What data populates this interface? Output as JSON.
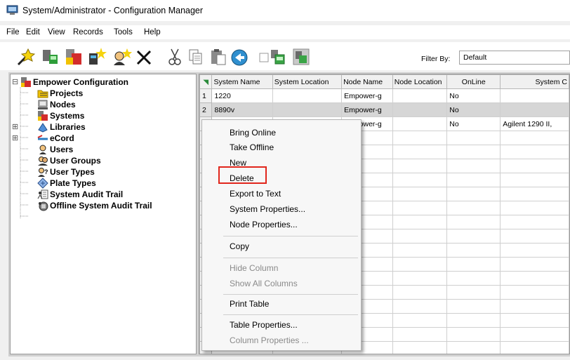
{
  "window": {
    "title": "System/Administrator - Configuration Manager"
  },
  "menu": [
    "File",
    "Edit",
    "View",
    "Records",
    "Tools",
    "Help"
  ],
  "toolbar": {
    "filter_label": "Filter By:",
    "filter_value": "Default",
    "icons": [
      "new-wand-icon",
      "node-icon",
      "system-icon",
      "new-sparkle-icon",
      "user-sparkle-icon",
      "delete-x-icon",
      "cut-icon",
      "copy-icon",
      "paste-icon",
      "go-online-icon",
      "checkbox-icon",
      "system-config-icon",
      "system-config-alt-icon"
    ]
  },
  "tree": {
    "items": [
      {
        "label": "Empower Configuration",
        "icon": "empower-config-icon",
        "expander": "⊟"
      },
      {
        "label": "Projects",
        "icon": "projects-folder-icon"
      },
      {
        "label": "Nodes",
        "icon": "nodes-icon"
      },
      {
        "label": "Systems",
        "icon": "systems-icon"
      },
      {
        "label": "Libraries",
        "icon": "libraries-icon",
        "expander": "⊞"
      },
      {
        "label": "eCord",
        "icon": "ecord-icon",
        "expander": "⊞"
      },
      {
        "label": "Users",
        "icon": "users-icon"
      },
      {
        "label": "User Groups",
        "icon": "user-groups-icon"
      },
      {
        "label": "User Types",
        "icon": "user-types-icon"
      },
      {
        "label": "Plate Types",
        "icon": "plate-types-icon"
      },
      {
        "label": "System Audit Trail",
        "icon": "system-audit-trail-icon"
      },
      {
        "label": "Offline System Audit Trail",
        "icon": "offline-audit-trail-icon"
      }
    ]
  },
  "grid": {
    "columns": [
      "System Name",
      "System Location",
      "Node Name",
      "Node Location",
      "OnLine",
      "System C"
    ],
    "rows": [
      {
        "n": "1",
        "cells": [
          "1220",
          "",
          "Empower-g",
          "",
          "No",
          ""
        ]
      },
      {
        "n": "2",
        "cells": [
          "8890v",
          "",
          "Empower-g",
          "",
          "No",
          ""
        ]
      },
      {
        "n": "",
        "cells": [
          "",
          "",
          "Empower-g",
          "",
          "No",
          "Agilent 1290 II,"
        ]
      }
    ]
  },
  "context_menu": {
    "items": [
      {
        "label": "Bring Online",
        "enabled": true
      },
      {
        "label": "Take Offline",
        "enabled": true
      },
      {
        "label": "New",
        "enabled": true
      },
      {
        "label": "Delete",
        "enabled": true,
        "highlighted": true
      },
      {
        "label": "Export to Text",
        "enabled": true
      },
      {
        "label": "System Properties...",
        "enabled": true
      },
      {
        "label": "Node Properties...",
        "enabled": true
      },
      {
        "label": "Copy",
        "enabled": true
      },
      {
        "label": "Hide Column",
        "enabled": false
      },
      {
        "label": "Show All Columns",
        "enabled": false
      },
      {
        "label": "Print Table",
        "enabled": true
      },
      {
        "label": "Table Properties...",
        "enabled": true
      },
      {
        "label": "Column Properties ...",
        "enabled": false
      }
    ]
  },
  "colors": {
    "highlight_box": "#e1261c",
    "selected_row": "#d6d6d6"
  }
}
